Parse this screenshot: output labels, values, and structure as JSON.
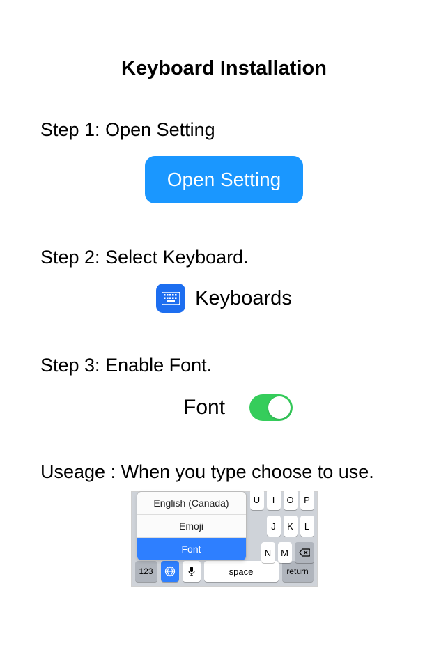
{
  "title": "Keyboard Installation",
  "step1": {
    "label": "Step 1: Open Setting",
    "button": "Open Setting"
  },
  "step2": {
    "label": "Step 2: Select Keyboard.",
    "item": "Keyboards"
  },
  "step3": {
    "label": "Step 3: Enable Font.",
    "item": "Font"
  },
  "usage": {
    "label": "Useage : When you type choose to use.",
    "menu": {
      "english": "English (Canada)",
      "emoji": "Emoji",
      "font": "Font"
    },
    "keys_r1": [
      "U",
      "I",
      "O",
      "P"
    ],
    "keys_r2": [
      "J",
      "K",
      "L"
    ],
    "keys_r3": [
      "N",
      "M"
    ],
    "bottom": {
      "num": "123",
      "space": "space",
      "return": "return"
    }
  }
}
